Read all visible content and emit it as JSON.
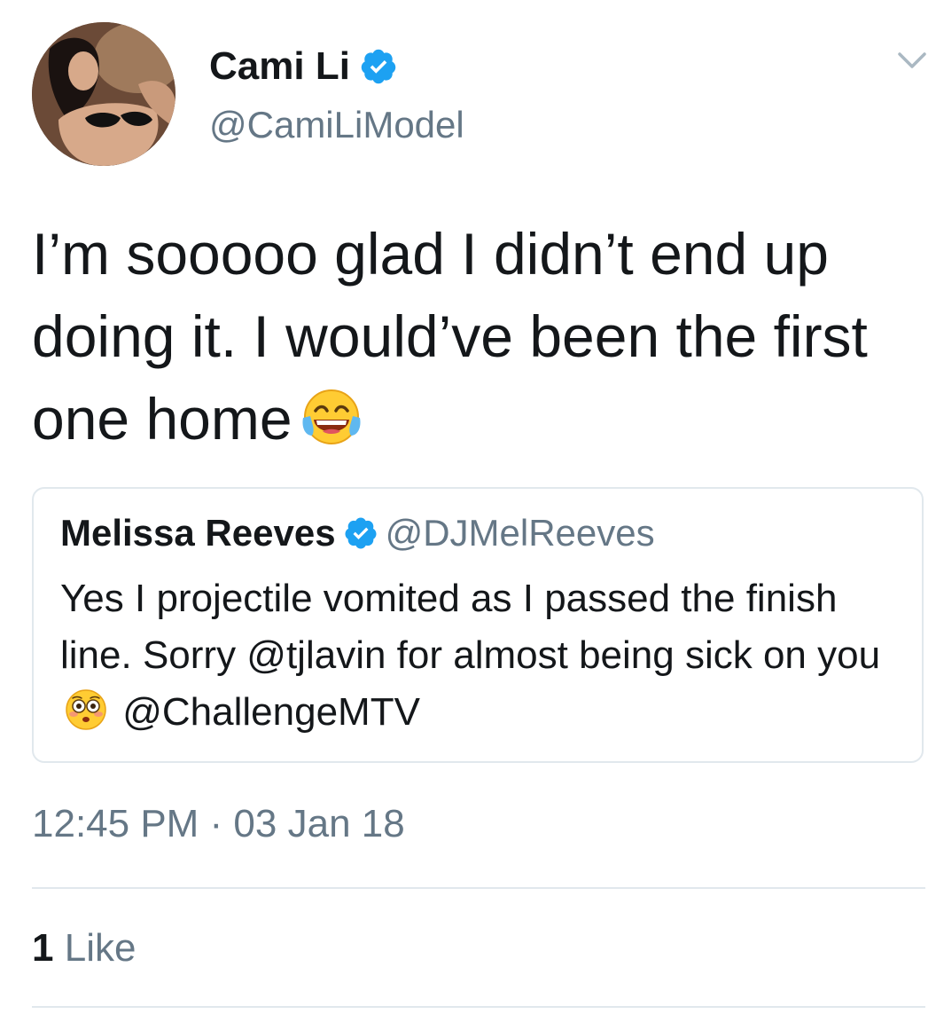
{
  "author": {
    "display_name": "Cami Li",
    "handle": "@CamiLiModel",
    "verified": true
  },
  "tweet": {
    "text": "I’m sooooo glad I didn’t end up doing it. I would’ve been the first one home",
    "emoji": "face-with-tears-of-joy-icon"
  },
  "quoted_tweet": {
    "display_name": "Melissa Reeves",
    "handle": "@DJMelReeves",
    "verified": true,
    "text_before_emoji": "Yes I projectile vomited as I passed the finish line. Sorry @tjlavin for almost being sick on you",
    "emoji": "flushed-face-icon",
    "text_after_emoji": "@ChallengeMTV"
  },
  "timestamp": "12:45 PM · 03 Jan 18",
  "likes": {
    "count": "1",
    "label": "Like"
  },
  "colors": {
    "text_primary": "#14171a",
    "text_secondary": "#657786",
    "verified_blue": "#1da1f2",
    "divider": "#e1e8ed"
  }
}
